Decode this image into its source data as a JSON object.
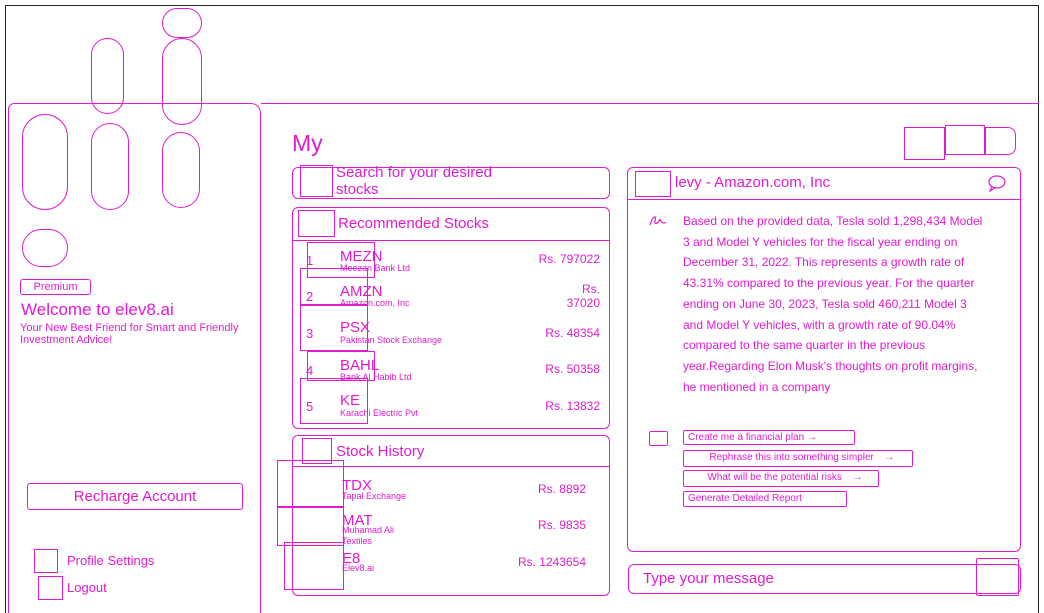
{
  "sidebar": {
    "premium_badge": "Premium",
    "welcome": "Welcome to elev8.ai",
    "tagline": "Your New Best Friend for Smart and Friendly Investment Advice!",
    "recharge_label": "Recharge Account",
    "profile_label": "Profile Settings",
    "logout_label": "Logout"
  },
  "main": {
    "title": "My",
    "search_placeholder": "Search for your desired stocks",
    "recommended": {
      "header": "Recommended Stocks",
      "rows": [
        {
          "num": "1",
          "ticker": "MEZN",
          "name": "Meezan Bank Ltd",
          "price": "Rs. 797022"
        },
        {
          "num": "2",
          "ticker": "AMZN",
          "name": "Amazon.com, Inc",
          "price": "Rs. 37020"
        },
        {
          "num": "3",
          "ticker": "PSX",
          "name": "Pakistan Stock Exchange",
          "price": "Rs. 48354"
        },
        {
          "num": "4",
          "ticker": "BAHL",
          "name": "Bank Al Habib Ltd",
          "price": "Rs. 50358"
        },
        {
          "num": "5",
          "ticker": "KE",
          "name": "Karachi Electric Pvt",
          "price": "Rs. 13832"
        }
      ]
    },
    "history": {
      "header": "Stock History",
      "rows": [
        {
          "ticker": "TDX",
          "name": "Tapal Exchange",
          "price": "Rs. 8892"
        },
        {
          "ticker": "MAT",
          "name": "Muhamad Ali Textiles",
          "price": "Rs. 9835"
        },
        {
          "ticker": "E8",
          "name": "Elev8.ai",
          "price": "Rs. 1243654"
        }
      ]
    }
  },
  "chat": {
    "title": "levy - Amazon.com, Inc",
    "message": "Based on the provided data, Tesla sold 1,298,434 Model 3 and Model Y vehicles for the fiscal year ending on December 31, 2022. This represents a growth rate of 43.31% compared to the previous year. For the quarter ending on June 30, 2023, Tesla sold 460,211 Model 3 and Model Y vehicles, with a growth rate of 90.04% compared to the same quarter in the previous year.Regarding Elon Musk's thoughts on profit margins, he mentioned in a company",
    "suggestions": [
      "Create me a financial plan",
      "Rephrase this into something simpler",
      "What will be the potential risks",
      "Generate Detailed Report"
    ],
    "arrow": "→",
    "input_placeholder": "Type your message"
  }
}
